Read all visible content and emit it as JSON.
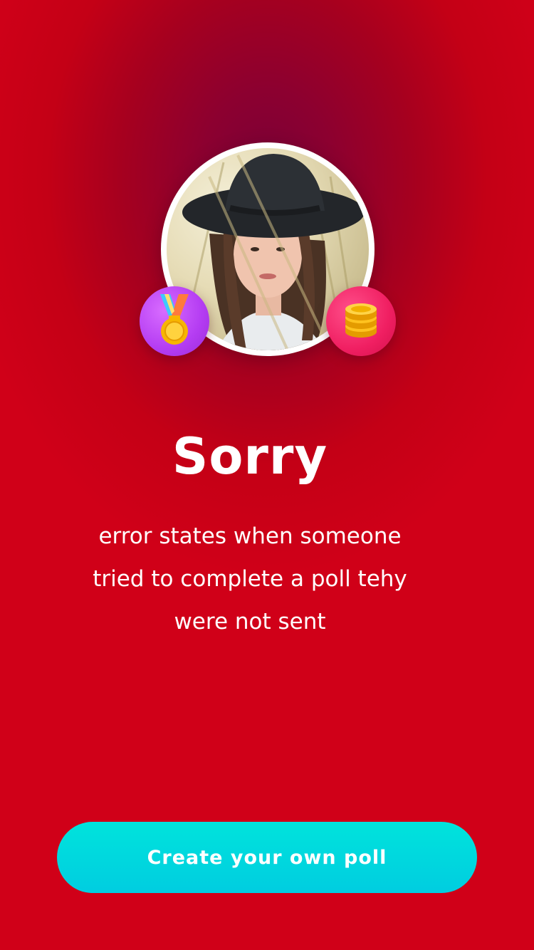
{
  "profile": {
    "avatar": "profile-photo",
    "badges": [
      {
        "icon": "medal-icon",
        "color": "#b43cf2"
      },
      {
        "icon": "coins-icon",
        "color": "#f01f62"
      }
    ]
  },
  "error": {
    "title": "Sorry",
    "message": "error states when someone tried to complete a poll tehy were not sent"
  },
  "cta": {
    "label": "Create your own poll",
    "color": "#00d8df"
  },
  "colors": {
    "background_center": "#7a0038",
    "background_edge": "#d00018"
  }
}
